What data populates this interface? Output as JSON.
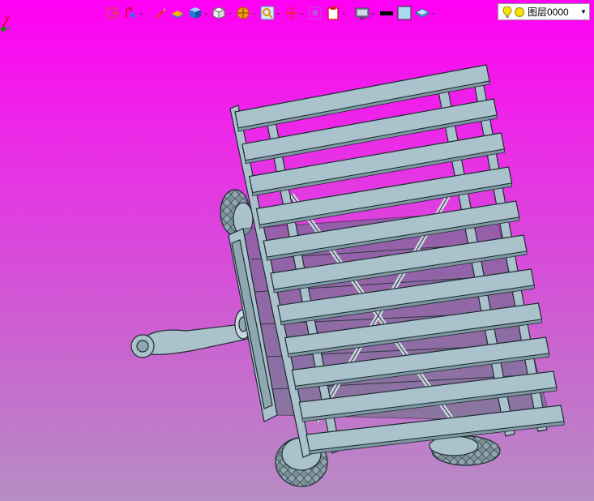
{
  "toolbar": {
    "items": [
      {
        "name": "exit-sketch-icon",
        "dropdown": false
      },
      {
        "name": "view-orient-icon",
        "dropdown": true
      },
      {
        "name": "pen-icon",
        "dropdown": false
      },
      {
        "name": "section-icon",
        "dropdown": false
      },
      {
        "name": "cube-shaded-icon",
        "dropdown": true
      },
      {
        "name": "cube-white-icon",
        "dropdown": true
      },
      {
        "name": "render-ball-icon",
        "dropdown": true
      },
      {
        "name": "zoom-icon",
        "dropdown": true
      },
      {
        "name": "pan-cross-icon",
        "dropdown": true
      },
      {
        "name": "frame-select-icon",
        "dropdown": false
      },
      {
        "name": "clipboard-icon",
        "dropdown": true
      },
      {
        "name": "monitor-icon",
        "dropdown": true
      },
      {
        "name": "line-color-icon",
        "dropdown": false
      },
      {
        "name": "fill-color-icon",
        "dropdown": false
      },
      {
        "name": "layer-stack-icon",
        "dropdown": true
      }
    ]
  },
  "layer": {
    "name": "图层0000",
    "bulb_color": "#f5e600",
    "dot_color": "#f2e200"
  },
  "colors": {
    "bg_top": "#ff00f4",
    "bg_bottom": "#b78dc4",
    "model_face": "#a9c2cc",
    "model_edge": "#1e2a30"
  }
}
